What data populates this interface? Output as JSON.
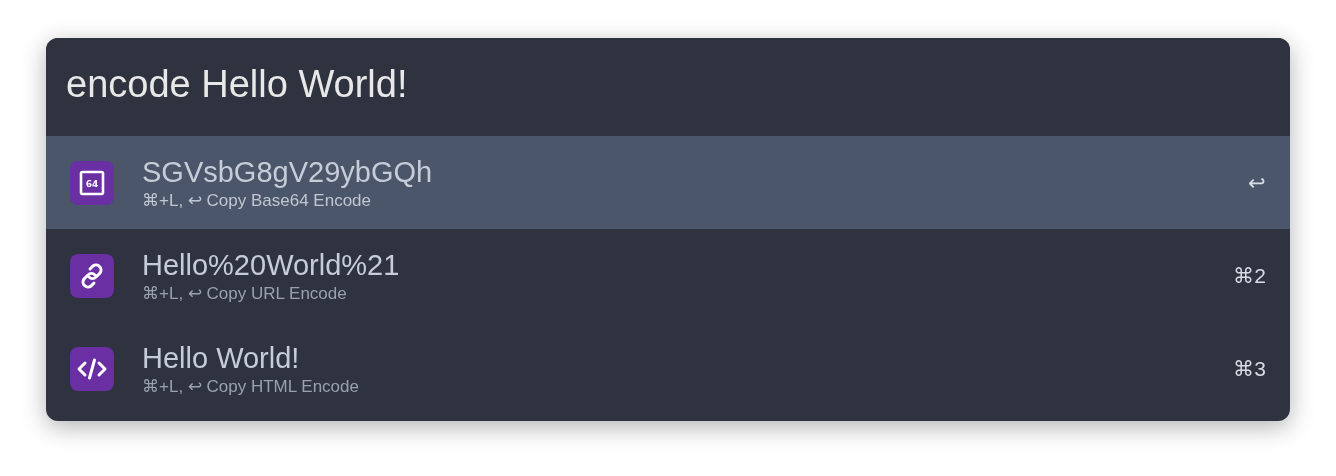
{
  "search": {
    "value": "encode Hello World!"
  },
  "results": [
    {
      "kind": "base64",
      "icon_text": "64",
      "title": "SGVsbG8gV29ybGQh",
      "subtitle": "⌘+L, ↩ Copy Base64 Encode",
      "shortcut": "↩",
      "selected": true
    },
    {
      "kind": "link",
      "title": "Hello%20World%21",
      "subtitle": "⌘+L, ↩ Copy URL Encode",
      "shortcut": "⌘2",
      "selected": false
    },
    {
      "kind": "code",
      "title": "Hello World!",
      "subtitle": "⌘+L, ↩ Copy HTML Encode",
      "shortcut": "⌘3",
      "selected": false
    }
  ]
}
